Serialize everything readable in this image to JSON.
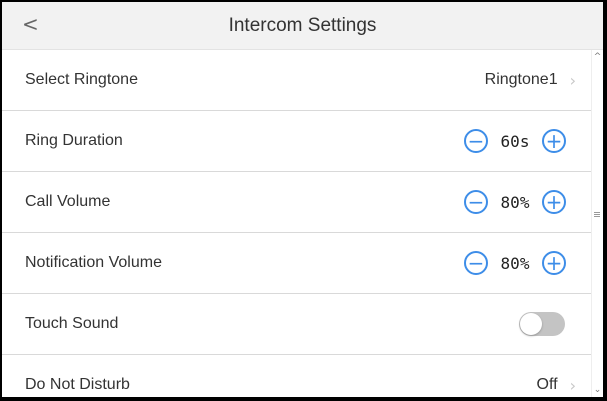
{
  "header": {
    "back_label": "<",
    "title": "Intercom Settings"
  },
  "rows": {
    "ringtone": {
      "label": "Select Ringtone",
      "value": "Ringtone1",
      "chevron": "›"
    },
    "ring_duration": {
      "label": "Ring Duration",
      "value": "60s",
      "minus": "−",
      "plus": "+"
    },
    "call_volume": {
      "label": "Call Volume",
      "value": "80%",
      "minus": "−",
      "plus": "+"
    },
    "notification_volume": {
      "label": "Notification Volume",
      "value": "80%",
      "minus": "−",
      "plus": "+"
    },
    "touch_sound": {
      "label": "Touch Sound",
      "enabled": false
    },
    "do_not_disturb": {
      "label": "Do Not Disturb",
      "value": "Off",
      "chevron": "›"
    }
  },
  "scrollbar": {
    "up": "^",
    "down": "⌄"
  },
  "colors": {
    "accent": "#3d8de8",
    "header_bg": "#f2f2f2",
    "toggle_off": "#c4c4c4",
    "divider": "#d9d9d9"
  }
}
